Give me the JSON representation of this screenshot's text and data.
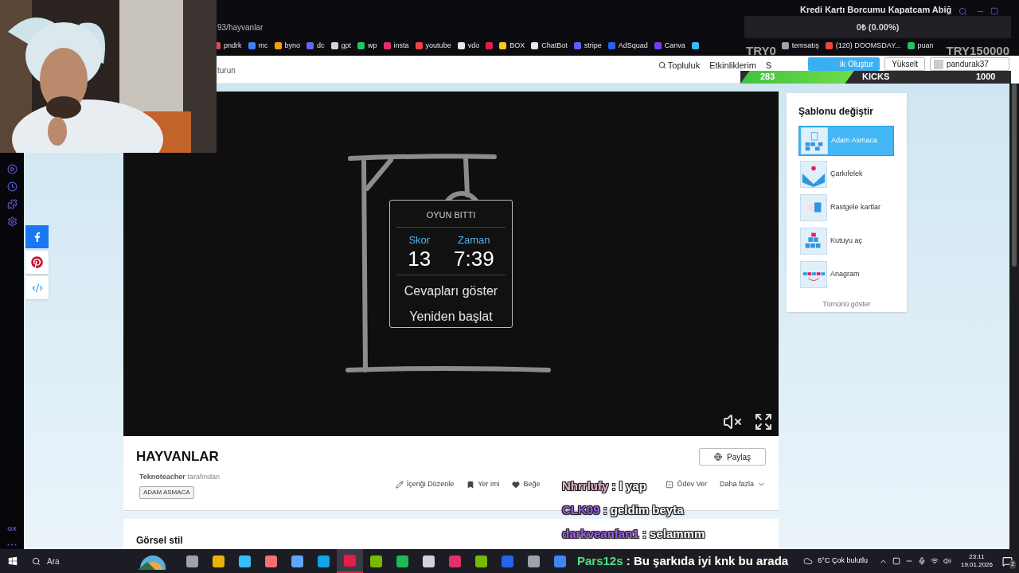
{
  "browser": {
    "url": "93/hayvanlar",
    "bookmarks": [
      {
        "label": "pndrk",
        "color": "#e5484d"
      },
      {
        "label": "mc",
        "color": "#3b82f6"
      },
      {
        "label": "byno",
        "color": "#f59e0b"
      },
      {
        "label": "dc",
        "color": "#6366f1"
      },
      {
        "label": "gpt",
        "color": "#d4d4d8"
      },
      {
        "label": "wp",
        "color": "#22c55e"
      },
      {
        "label": "insta",
        "color": "#e1306c"
      },
      {
        "label": "youtube",
        "color": "#ef4444"
      },
      {
        "label": "vdo",
        "color": "#e5e7eb"
      },
      {
        "color": "#e11d48"
      },
      {
        "label": "BOX",
        "color": "#facc15"
      },
      {
        "label": "ChatBot",
        "color": "#e5e7eb"
      },
      {
        "label": "stripe",
        "color": "#635bff"
      },
      {
        "label": "AdSquad",
        "color": "#2563eb"
      },
      {
        "label": "Canva",
        "color": "#7c3aed"
      },
      {
        "color": "#38bdf8"
      },
      {
        "label": "temsatış",
        "color": "#9ca3af"
      },
      {
        "label": "(120) DOOMSDAY...",
        "color": "#ef4444"
      },
      {
        "label": "puan",
        "color": "#22c55e"
      }
    ],
    "sidebar_label": "GX"
  },
  "site_nav": {
    "left_text": "turun",
    "links": [
      "Topluluk",
      "Etkinliklerim",
      "S"
    ],
    "create_button": "ik Oluştur",
    "upgrade_button": "Yükselt",
    "user": "pandurak37"
  },
  "game": {
    "title": "OYUN BITTI",
    "stats": [
      {
        "label": "Skor",
        "value": "13"
      },
      {
        "label": "Zaman",
        "value": "7:39"
      }
    ],
    "actions": [
      "Cevapları göster",
      "Yeniden başlat"
    ],
    "muted": true
  },
  "activity": {
    "title": "HAYVANLAR",
    "author": "Teknoteacher",
    "author_suffix": "tarafından",
    "tag": "ADAM ASMACA",
    "share_button": "Paylaş",
    "actions": [
      {
        "kind": "edit",
        "label": "İçeriği Düzenle"
      },
      {
        "kind": "bookmark",
        "label": "Yer imi"
      },
      {
        "kind": "like",
        "label": "Beğe"
      },
      {
        "kind": "gap"
      },
      {
        "kind": "assign",
        "label": "Ödev Ver"
      },
      {
        "kind": "more",
        "label": "Daha fazla"
      }
    ]
  },
  "section": {
    "title": "Görsel stil"
  },
  "templates": {
    "title": "Şablonu değiştir",
    "items": [
      {
        "kind": "hangman",
        "label": "Adam Asmaca",
        "selected": true
      },
      {
        "kind": "wheel",
        "label": "Çarkıfelek",
        "selected": false
      },
      {
        "kind": "cards",
        "label": "Rastgele kartlar",
        "selected": false
      },
      {
        "kind": "boxes",
        "label": "Kutuyu aç",
        "selected": false
      },
      {
        "kind": "anagram",
        "label": "Anagram",
        "selected": false
      }
    ],
    "show_all": "Tümünü göster"
  },
  "stream_overlay": {
    "goal_title": "Kredi Kartı Borcumu Kapatcam Abiğ",
    "goal_amount": "0₺ (0.00%)",
    "goal_start": "TRY0",
    "goal_target": "TRY150000",
    "kicks": {
      "count": "283",
      "label": "KICKS",
      "target": "1000",
      "level": 0.42
    },
    "chat": [
      {
        "user": "Nhrrlufy",
        "text": ": l yap",
        "color": "#e8b4cf"
      },
      {
        "user": "CLK09",
        "text": ": geldim beyta",
        "color": "#9b5de5"
      },
      {
        "user": "darkveanfan1",
        "text": ": selammm",
        "color": "#9b5de5"
      }
    ],
    "taskbar_chat": {
      "user": "Pars12s",
      "text": ": Bu şarkıda iyi knk bu arada",
      "color": "#4ade80"
    }
  },
  "taskbar": {
    "search_placeholder": "Ara",
    "apps": [
      {
        "color": "#9ca3af",
        "selected": false
      },
      {
        "color": "#eab308",
        "selected": false
      },
      {
        "color": "#38bdf8",
        "selected": false
      },
      {
        "color": "#f87171",
        "selected": false
      },
      {
        "color": "#60a5fa",
        "selected": false
      },
      {
        "color": "#0ea5e9",
        "selected": false
      },
      {
        "color": "#e11d48",
        "selected": true
      },
      {
        "color": "#76b900",
        "selected": false
      },
      {
        "color": "#1db954",
        "selected": false
      },
      {
        "color": "#d4d4d8",
        "selected": false
      },
      {
        "color": "#e1306c",
        "selected": false
      },
      {
        "color": "#76b900",
        "selected": false
      },
      {
        "color": "#2563eb",
        "selected": false
      },
      {
        "color": "#9ca3af",
        "selected": false
      },
      {
        "color": "#4285f4",
        "selected": false
      }
    ],
    "temperature": "6°C",
    "weather": "Çok bulutlu",
    "time": "23:11",
    "date": "19.01.2026",
    "notifications": "2"
  }
}
